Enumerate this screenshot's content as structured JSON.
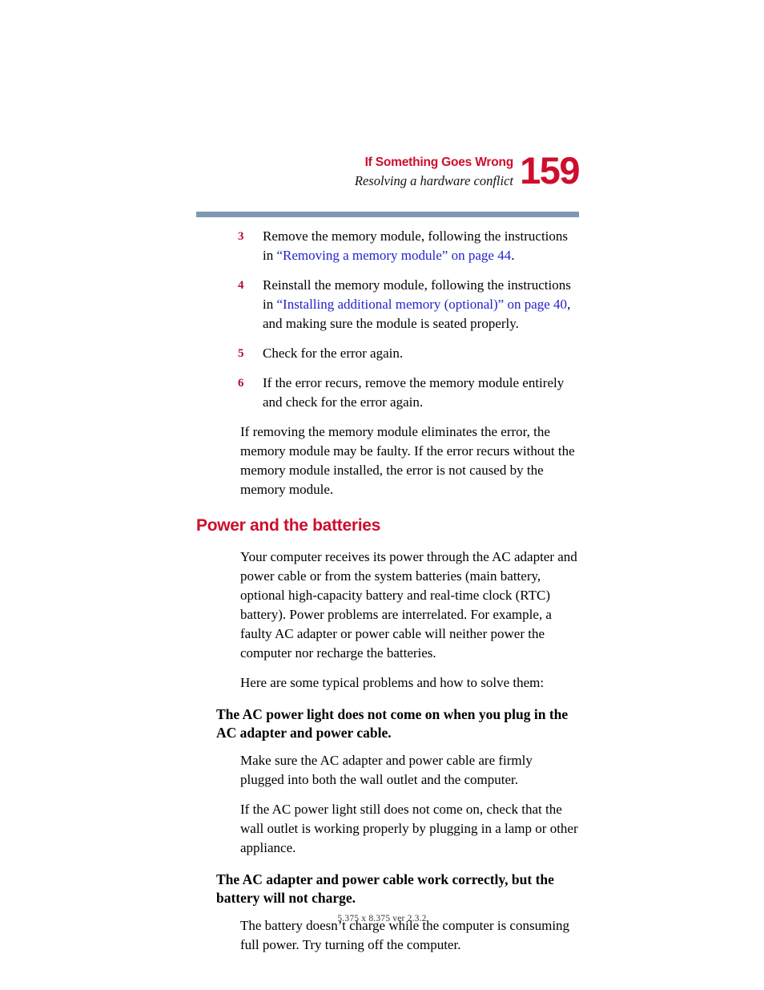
{
  "header": {
    "chapter_title": "If Something Goes Wrong",
    "section_title": "Resolving a hardware conflict",
    "page_number": "159",
    "accent_color": "#CE0E2D",
    "rule_color": "#7F97B3"
  },
  "steps": [
    {
      "number": "3",
      "prefix": "Remove the memory module, following the instructions in ",
      "link": "“Removing a memory module” on page 44",
      "suffix": "."
    },
    {
      "number": "4",
      "prefix": "Reinstall the memory module, following the instructions in ",
      "link": "“Installing additional memory (optional)” on page 40",
      "suffix": ", and making sure the module is seated properly."
    },
    {
      "number": "5",
      "prefix": "Check for the error again.",
      "link": "",
      "suffix": ""
    },
    {
      "number": "6",
      "prefix": "If the error recurs, remove the memory module entirely and check for the error again.",
      "link": "",
      "suffix": ""
    }
  ],
  "memory_note": "If removing the memory module eliminates the error, the memory module may be faulty. If the error recurs without the memory module installed, the error is not caused by the memory module.",
  "power_section": {
    "heading": "Power and the batteries",
    "intro": "Your computer receives its power through the AC adapter and power cable or from the system batteries (main battery, optional high-capacity battery and real-time clock (RTC) battery). Power problems are interrelated. For example, a faulty AC adapter or power cable will neither power the computer nor recharge the batteries.",
    "lead_in": "Here are some typical problems and how to solve them:",
    "problems": [
      {
        "subheading": "The AC power light does not come on when you plug in the AC adapter and power cable.",
        "paragraphs": [
          "Make sure the AC adapter and power cable are firmly plugged into both the wall outlet and the computer.",
          "If the AC power light still does not come on, check that the wall outlet is working properly by plugging in a lamp or other appliance."
        ]
      },
      {
        "subheading": "The AC adapter and power cable work correctly, but the battery will not charge.",
        "paragraphs": [
          "The battery doesn’t charge while the computer is consuming full power. Try turning off the computer."
        ]
      }
    ]
  },
  "footer": {
    "text": "5.375 x 8.375 ver 2.3.2"
  }
}
